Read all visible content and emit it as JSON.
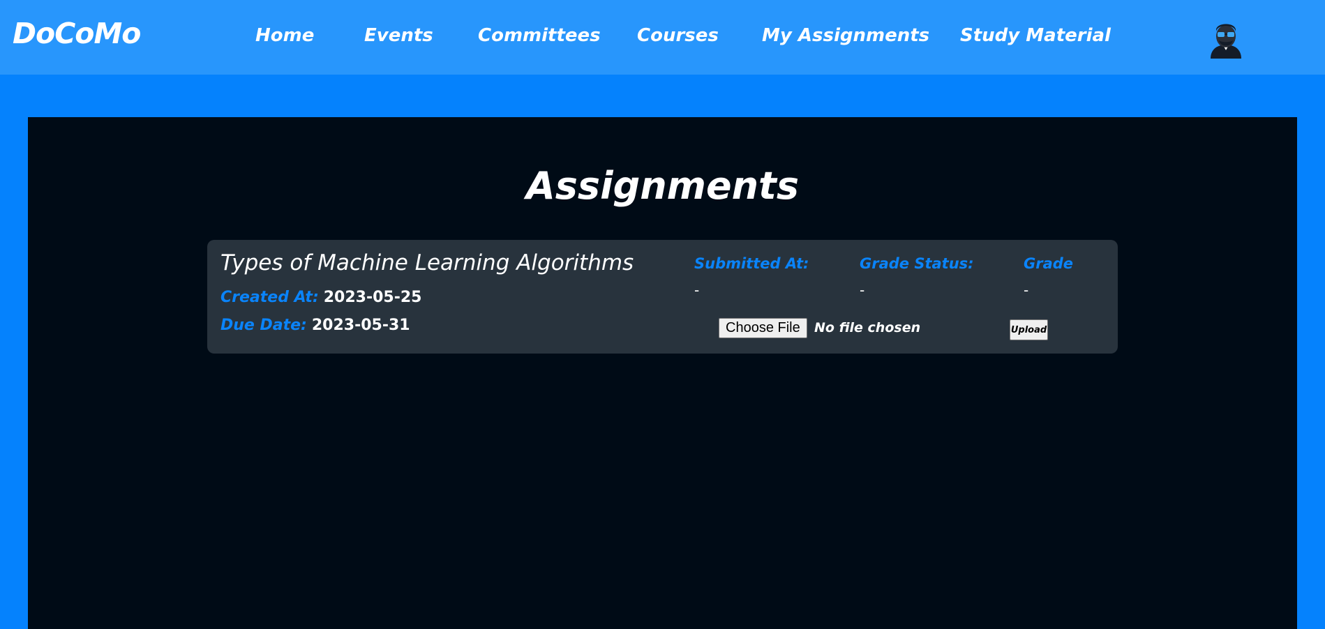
{
  "brand": "DoCoMo",
  "nav": {
    "items": [
      "Home",
      "Events",
      "Committees",
      "Courses",
      "My Assignments",
      "Study Material"
    ],
    "avatar_icon": "user-avatar-icon"
  },
  "page": {
    "title": "Assignments"
  },
  "assignment": {
    "title": "Types of Machine Learning Algorithms",
    "created_label": "Created At:",
    "created_value": "2023-05-25",
    "due_label": "Due Date:",
    "due_value": "2023-05-31",
    "submitted_label": "Submitted At:",
    "submitted_value": "-",
    "grade_status_label": "Grade Status:",
    "grade_status_value": "-",
    "grade_label": "Grade",
    "grade_value": "-",
    "choose_file_label": "Choose File",
    "file_status": "No file chosen",
    "upload_label": "Upload"
  },
  "colors": {
    "navbar": "#2896fc",
    "page_background": "#0582fd",
    "panel": "#000b16",
    "card": "#28333d",
    "accent": "#0a84fb"
  }
}
